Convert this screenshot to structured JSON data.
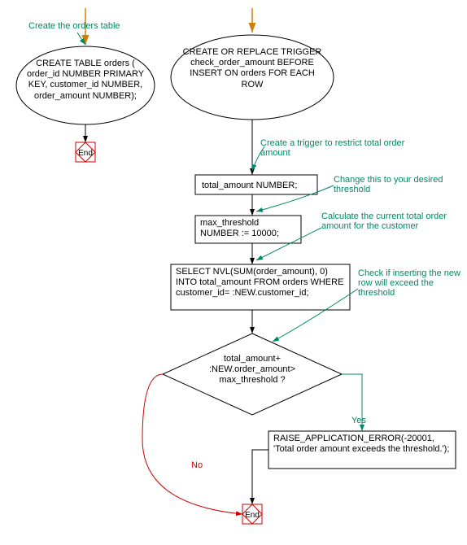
{
  "annotations": {
    "create_table": "Create the orders table",
    "create_trigger": "Create a trigger to restrict total order amount",
    "threshold_note": "Change this to your desired threshold",
    "calc_note": "Calculate the current total order amount for the customer",
    "check_note": "Check if inserting the new row will exceed the threshold"
  },
  "nodes": {
    "create_table_stmt": "CREATE TABLE orders ( order_id NUMBER PRIMARY KEY, customer_id NUMBER, order_amount NUMBER);",
    "end1": "End",
    "trigger_stmt": "CREATE OR REPLACE TRIGGER check_order_amount BEFORE INSERT ON orders FOR EACH ROW",
    "total_amount_decl": "total_amount NUMBER;",
    "max_threshold_decl": "max_threshold NUMBER := 10000;",
    "select_stmt": "SELECT NVL(SUM(order_amount), 0) INTO total_amount FROM orders WHERE customer_id= :NEW.customer_id;",
    "decision": "total_amount+ :NEW.order_amount> max_threshold ?",
    "raise_error": "RAISE_APPLICATION_ERROR(-20001, 'Total order amount exceeds the threshold.');",
    "end2": "End"
  },
  "labels": {
    "yes": "Yes",
    "no": "No"
  }
}
